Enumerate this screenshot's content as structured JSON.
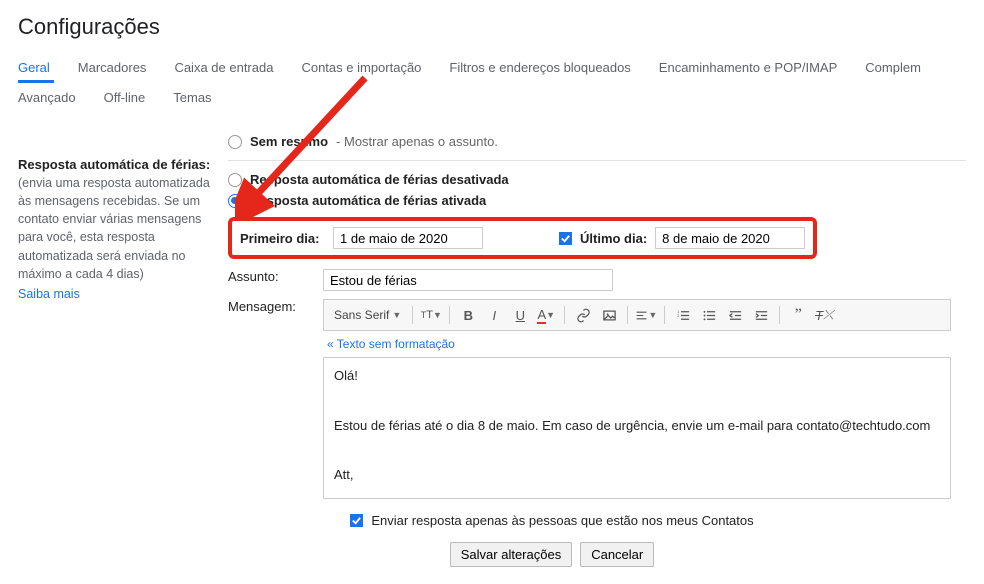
{
  "page_title": "Configurações",
  "tabs_row1": [
    "Geral",
    "Marcadores",
    "Caixa de entrada",
    "Contas e importação",
    "Filtros e endereços bloqueados",
    "Encaminhamento e POP/IMAP",
    "Complem"
  ],
  "tabs_row2": [
    "Avançado",
    "Off-line",
    "Temas"
  ],
  "active_tab": "Geral",
  "summary": {
    "radio_label": "Sem resumo",
    "dash_text": "- Mostrar apenas o assunto."
  },
  "sidebar": {
    "label": "Resposta automática de férias:",
    "desc": "(envia uma resposta automatizada às mensagens recebidas. Se um contato enviar várias mensagens para você, esta resposta automatizada será enviada no máximo a cada 4 dias)",
    "learn_more": "Saiba mais"
  },
  "vacation": {
    "off_label": "Resposta automática de férias desativada",
    "on_label": "Resposta automática de férias ativada",
    "first_day_label": "Primeiro dia:",
    "first_day_value": "1 de maio de 2020",
    "last_day_label": "Último dia:",
    "last_day_value": "8 de maio de 2020",
    "subject_label": "Assunto:",
    "subject_value": "Estou de férias",
    "message_label": "Mensagem:",
    "font_name": "Sans Serif",
    "plain_text_link": "« Texto sem formatação",
    "body_greeting": "Olá!",
    "body_main": "Estou de férias até o dia 8 de maio. Em caso de urgência, envie um e-mail para contato@techtudo.com",
    "body_sign": "Att,",
    "contacts_only": "Enviar resposta apenas às pessoas que estão nos meus Contatos"
  },
  "buttons": {
    "save": "Salvar alterações",
    "cancel": "Cancelar"
  }
}
